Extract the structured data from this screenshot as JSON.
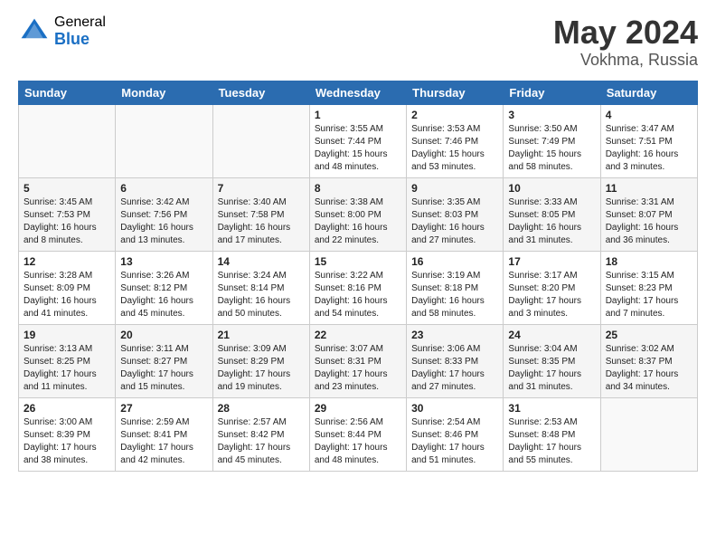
{
  "header": {
    "logo_general": "General",
    "logo_blue": "Blue",
    "title": "May 2024",
    "location": "Vokhma, Russia"
  },
  "weekdays": [
    "Sunday",
    "Monday",
    "Tuesday",
    "Wednesday",
    "Thursday",
    "Friday",
    "Saturday"
  ],
  "weeks": [
    [
      {
        "day": "",
        "info": ""
      },
      {
        "day": "",
        "info": ""
      },
      {
        "day": "",
        "info": ""
      },
      {
        "day": "1",
        "info": "Sunrise: 3:55 AM\nSunset: 7:44 PM\nDaylight: 15 hours\nand 48 minutes."
      },
      {
        "day": "2",
        "info": "Sunrise: 3:53 AM\nSunset: 7:46 PM\nDaylight: 15 hours\nand 53 minutes."
      },
      {
        "day": "3",
        "info": "Sunrise: 3:50 AM\nSunset: 7:49 PM\nDaylight: 15 hours\nand 58 minutes."
      },
      {
        "day": "4",
        "info": "Sunrise: 3:47 AM\nSunset: 7:51 PM\nDaylight: 16 hours\nand 3 minutes."
      }
    ],
    [
      {
        "day": "5",
        "info": "Sunrise: 3:45 AM\nSunset: 7:53 PM\nDaylight: 16 hours\nand 8 minutes."
      },
      {
        "day": "6",
        "info": "Sunrise: 3:42 AM\nSunset: 7:56 PM\nDaylight: 16 hours\nand 13 minutes."
      },
      {
        "day": "7",
        "info": "Sunrise: 3:40 AM\nSunset: 7:58 PM\nDaylight: 16 hours\nand 17 minutes."
      },
      {
        "day": "8",
        "info": "Sunrise: 3:38 AM\nSunset: 8:00 PM\nDaylight: 16 hours\nand 22 minutes."
      },
      {
        "day": "9",
        "info": "Sunrise: 3:35 AM\nSunset: 8:03 PM\nDaylight: 16 hours\nand 27 minutes."
      },
      {
        "day": "10",
        "info": "Sunrise: 3:33 AM\nSunset: 8:05 PM\nDaylight: 16 hours\nand 31 minutes."
      },
      {
        "day": "11",
        "info": "Sunrise: 3:31 AM\nSunset: 8:07 PM\nDaylight: 16 hours\nand 36 minutes."
      }
    ],
    [
      {
        "day": "12",
        "info": "Sunrise: 3:28 AM\nSunset: 8:09 PM\nDaylight: 16 hours\nand 41 minutes."
      },
      {
        "day": "13",
        "info": "Sunrise: 3:26 AM\nSunset: 8:12 PM\nDaylight: 16 hours\nand 45 minutes."
      },
      {
        "day": "14",
        "info": "Sunrise: 3:24 AM\nSunset: 8:14 PM\nDaylight: 16 hours\nand 50 minutes."
      },
      {
        "day": "15",
        "info": "Sunrise: 3:22 AM\nSunset: 8:16 PM\nDaylight: 16 hours\nand 54 minutes."
      },
      {
        "day": "16",
        "info": "Sunrise: 3:19 AM\nSunset: 8:18 PM\nDaylight: 16 hours\nand 58 minutes."
      },
      {
        "day": "17",
        "info": "Sunrise: 3:17 AM\nSunset: 8:20 PM\nDaylight: 17 hours\nand 3 minutes."
      },
      {
        "day": "18",
        "info": "Sunrise: 3:15 AM\nSunset: 8:23 PM\nDaylight: 17 hours\nand 7 minutes."
      }
    ],
    [
      {
        "day": "19",
        "info": "Sunrise: 3:13 AM\nSunset: 8:25 PM\nDaylight: 17 hours\nand 11 minutes."
      },
      {
        "day": "20",
        "info": "Sunrise: 3:11 AM\nSunset: 8:27 PM\nDaylight: 17 hours\nand 15 minutes."
      },
      {
        "day": "21",
        "info": "Sunrise: 3:09 AM\nSunset: 8:29 PM\nDaylight: 17 hours\nand 19 minutes."
      },
      {
        "day": "22",
        "info": "Sunrise: 3:07 AM\nSunset: 8:31 PM\nDaylight: 17 hours\nand 23 minutes."
      },
      {
        "day": "23",
        "info": "Sunrise: 3:06 AM\nSunset: 8:33 PM\nDaylight: 17 hours\nand 27 minutes."
      },
      {
        "day": "24",
        "info": "Sunrise: 3:04 AM\nSunset: 8:35 PM\nDaylight: 17 hours\nand 31 minutes."
      },
      {
        "day": "25",
        "info": "Sunrise: 3:02 AM\nSunset: 8:37 PM\nDaylight: 17 hours\nand 34 minutes."
      }
    ],
    [
      {
        "day": "26",
        "info": "Sunrise: 3:00 AM\nSunset: 8:39 PM\nDaylight: 17 hours\nand 38 minutes."
      },
      {
        "day": "27",
        "info": "Sunrise: 2:59 AM\nSunset: 8:41 PM\nDaylight: 17 hours\nand 42 minutes."
      },
      {
        "day": "28",
        "info": "Sunrise: 2:57 AM\nSunset: 8:42 PM\nDaylight: 17 hours\nand 45 minutes."
      },
      {
        "day": "29",
        "info": "Sunrise: 2:56 AM\nSunset: 8:44 PM\nDaylight: 17 hours\nand 48 minutes."
      },
      {
        "day": "30",
        "info": "Sunrise: 2:54 AM\nSunset: 8:46 PM\nDaylight: 17 hours\nand 51 minutes."
      },
      {
        "day": "31",
        "info": "Sunrise: 2:53 AM\nSunset: 8:48 PM\nDaylight: 17 hours\nand 55 minutes."
      },
      {
        "day": "",
        "info": ""
      }
    ]
  ]
}
